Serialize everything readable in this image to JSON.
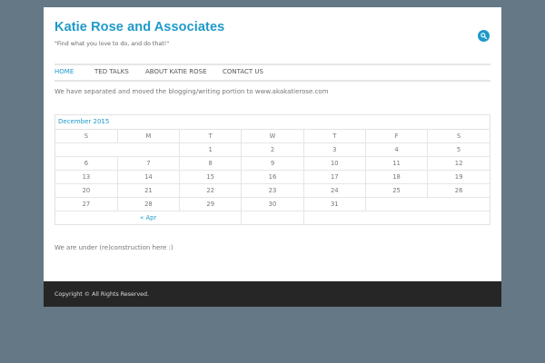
{
  "site": {
    "title": "Katie Rose and Associates",
    "tagline": "\"Find what you love to do, and do that!\"",
    "accent_color": "#1e9ac9",
    "search_icon": "search-icon"
  },
  "nav": {
    "items": [
      {
        "label": "HOME",
        "active": true
      },
      {
        "label": "TED TALKS",
        "active": false
      },
      {
        "label": "ABOUT KATIE ROSE",
        "active": false
      },
      {
        "label": "CONTACT US",
        "active": false
      }
    ]
  },
  "content": {
    "notice": "We have separated and moved the blogging/writing portion to www.akakatierose.com",
    "under_construction": "We are under (re)construction here :)"
  },
  "calendar": {
    "caption": "December 2015",
    "weekdays": [
      "S",
      "M",
      "T",
      "W",
      "T",
      "F",
      "S"
    ],
    "weeks": [
      [
        "",
        "",
        "1",
        "2",
        "3",
        "4",
        "5"
      ],
      [
        "6",
        "7",
        "8",
        "9",
        "10",
        "11",
        "12"
      ],
      [
        "13",
        "14",
        "15",
        "16",
        "17",
        "18",
        "19"
      ],
      [
        "20",
        "21",
        "22",
        "23",
        "24",
        "25",
        "26"
      ],
      [
        "27",
        "28",
        "29",
        "30",
        "31",
        "",
        ""
      ]
    ],
    "prev_link": "« Apr"
  },
  "footer": {
    "text": "Copyright © All Rights Reserved."
  }
}
